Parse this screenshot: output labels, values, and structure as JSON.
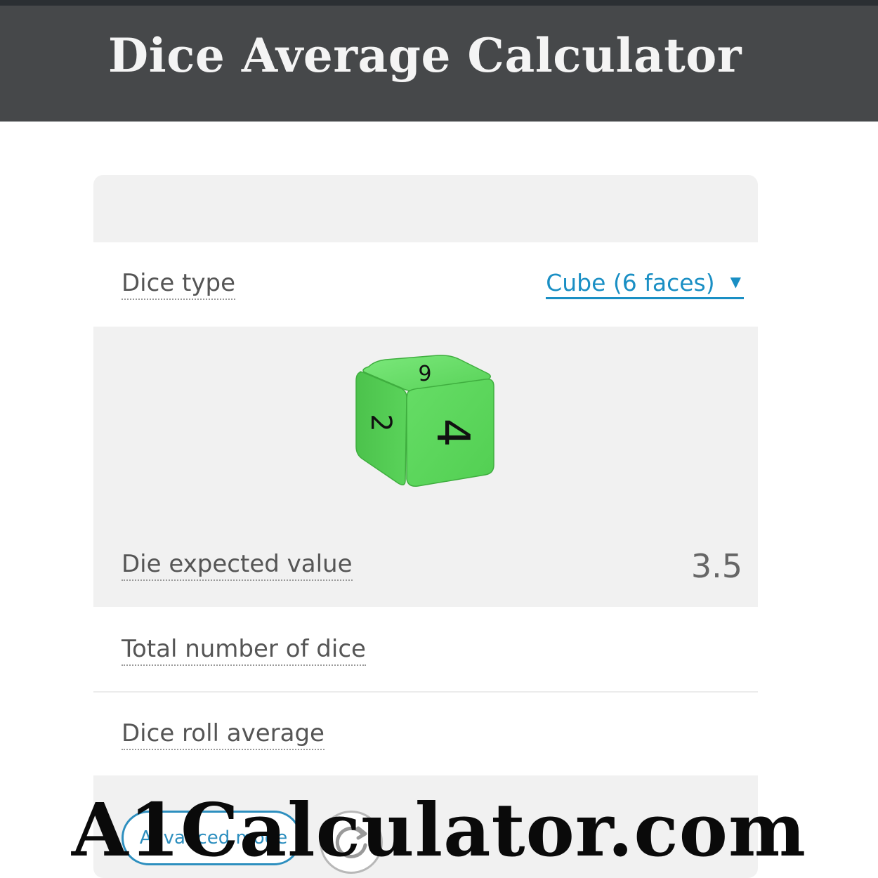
{
  "header": {
    "title": "Dice Average Calculator"
  },
  "calculator": {
    "dice_type": {
      "label": "Dice type",
      "selected": "Cube (6 faces)"
    },
    "die_faces_visible": {
      "top": "6",
      "left": "2",
      "front": "4"
    },
    "die_expected_value": {
      "label": "Die expected value",
      "value": "3.5"
    },
    "total_number_of_dice": {
      "label": "Total number of dice",
      "value": ""
    },
    "dice_roll_average": {
      "label": "Dice roll average",
      "value": ""
    },
    "advanced_mode_label": "Advanced mode"
  },
  "colors": {
    "header_bg": "#46484a",
    "accent_link": "#1a8fc4",
    "die_green": "#5bd85b"
  },
  "watermark": {
    "text": "A1Calculator.com"
  }
}
